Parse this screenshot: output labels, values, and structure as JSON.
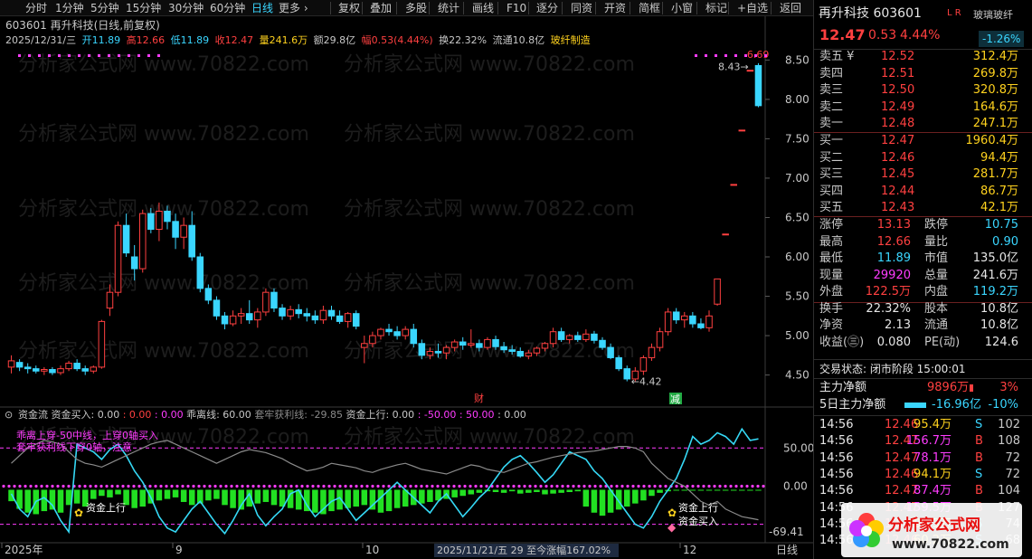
{
  "toolbar": {
    "items": [
      "分时",
      "1分钟",
      "5分钟",
      "15分钟",
      "30分钟",
      "60分钟",
      "日线",
      "更多 ›",
      "复权",
      "叠加",
      "多股",
      "统计",
      "画线",
      "F10",
      "逐分",
      "同资",
      "开资",
      "简框",
      "小窗",
      "标记",
      "+自选",
      "返回"
    ],
    "active": "日线"
  },
  "chart_header": {
    "title": "603601 再升科技(日线,前复权)",
    "date": "2025/12/31/三",
    "open": "开11.89",
    "high": "高12.66",
    "low": "低11.89",
    "close": "收12.47",
    "volume": "量241.6万",
    "amount": "额29.8亿",
    "change": "幅0.53(4.44%)",
    "turnover": "换22.32%",
    "float": "流通10.8亿",
    "sector": "玻纤制造"
  },
  "price_axis": {
    "labels": [
      "8.50",
      "8.00",
      "7.50",
      "7.00",
      "6.50",
      "6.00",
      "5.50",
      "5.00",
      "4.50"
    ],
    "min": 4.3,
    "max": 8.55
  },
  "annotations": {
    "high_label": "6.69",
    "low_label": "4.42",
    "right_label": "8.43",
    "cai": "财",
    "jian": "减"
  },
  "indicator": {
    "name": "资金流",
    "items": [
      {
        "label": "资金买入:",
        "value": "0.00"
      },
      {
        "label": ":",
        "value": "0.00"
      },
      {
        "label": ":",
        "value": "0.00"
      },
      {
        "label": "乖离线:",
        "value": "60.00"
      },
      {
        "label": "套牢获利线:",
        "value": "-29.85"
      },
      {
        "label": "资金上行:",
        "value": "0.00"
      },
      {
        "label": ":",
        "value": "-50.00"
      },
      {
        "label": ":",
        "value": "50.00"
      },
      {
        "label": ":",
        "value": "0.00"
      }
    ],
    "notes": [
      "乖离上穿-50中线，上穿0轴买入",
      "套牢获利线下穿0轴，注意"
    ],
    "marks": [
      "资金上行",
      "资金上行",
      "资金买入"
    ],
    "axis_labels": [
      "50.00",
      "0.00",
      "-69.41"
    ],
    "axis": {
      "min": -69.41,
      "max": 80
    }
  },
  "x_axis": {
    "labels": [
      "2025年",
      "9",
      "10",
      "12"
    ],
    "cursor": "2025/11/21/五 29 至今涨幅167.02%",
    "period": "日线"
  },
  "watermark": "分析家公式网 www.70822.com",
  "chart_data": {
    "type": "candlestick",
    "title": "603601 再升科技(日线,前复权)",
    "candles": [
      [
        4.6,
        4.75,
        4.52,
        4.68
      ],
      [
        4.66,
        4.7,
        4.55,
        4.6
      ],
      [
        4.6,
        4.65,
        4.52,
        4.58
      ],
      [
        4.58,
        4.62,
        4.52,
        4.55
      ],
      [
        4.55,
        4.6,
        4.5,
        4.57
      ],
      [
        4.57,
        4.6,
        4.5,
        4.53
      ],
      [
        4.53,
        4.62,
        4.5,
        4.58
      ],
      [
        4.58,
        4.68,
        4.55,
        4.65
      ],
      [
        4.65,
        4.7,
        4.55,
        4.58
      ],
      [
        4.58,
        4.62,
        4.5,
        4.55
      ],
      [
        4.55,
        4.62,
        4.52,
        4.6
      ],
      [
        4.6,
        5.2,
        4.58,
        5.18
      ],
      [
        5.35,
        5.65,
        5.25,
        5.55
      ],
      [
        5.55,
        6.45,
        5.5,
        6.4
      ],
      [
        6.4,
        6.55,
        6.0,
        6.05
      ],
      [
        6.0,
        6.15,
        5.7,
        5.85
      ],
      [
        5.85,
        6.6,
        5.8,
        6.55
      ],
      [
        6.55,
        6.62,
        6.3,
        6.35
      ],
      [
        6.35,
        6.69,
        6.2,
        6.58
      ],
      [
        6.58,
        6.65,
        6.35,
        6.45
      ],
      [
        6.45,
        6.55,
        6.1,
        6.25
      ],
      [
        6.25,
        6.5,
        6.1,
        6.4
      ],
      [
        6.4,
        6.58,
        5.95,
        6.0
      ],
      [
        6.0,
        6.05,
        5.55,
        5.6
      ],
      [
        5.6,
        5.65,
        5.4,
        5.45
      ],
      [
        5.45,
        5.5,
        5.2,
        5.25
      ],
      [
        5.25,
        5.3,
        5.08,
        5.15
      ],
      [
        5.15,
        5.32,
        5.12,
        5.25
      ],
      [
        5.25,
        5.35,
        5.15,
        5.28
      ],
      [
        5.28,
        5.45,
        5.15,
        5.2
      ],
      [
        5.2,
        5.35,
        5.1,
        5.3
      ],
      [
        5.3,
        5.6,
        5.25,
        5.55
      ],
      [
        5.55,
        5.6,
        5.3,
        5.35
      ],
      [
        5.35,
        5.4,
        5.2,
        5.25
      ],
      [
        5.25,
        5.38,
        5.2,
        5.33
      ],
      [
        5.33,
        5.4,
        5.22,
        5.28
      ],
      [
        5.28,
        5.35,
        5.18,
        5.25
      ],
      [
        5.25,
        5.32,
        5.15,
        5.2
      ],
      [
        5.2,
        5.38,
        5.15,
        5.32
      ],
      [
        5.32,
        5.38,
        5.2,
        5.25
      ],
      [
        5.25,
        5.32,
        5.15,
        5.18
      ],
      [
        5.18,
        5.3,
        5.1,
        5.28
      ],
      [
        5.28,
        5.32,
        5.08,
        5.12
      ],
      [
        4.85,
        5.0,
        4.65,
        4.9
      ],
      [
        4.9,
        5.05,
        4.85,
        5.0
      ],
      [
        5.0,
        5.1,
        4.95,
        5.08
      ],
      [
        5.08,
        5.15,
        5.0,
        5.05
      ],
      [
        5.05,
        5.12,
        4.95,
        5.0
      ],
      [
        5.0,
        5.12,
        4.95,
        5.08
      ],
      [
        5.08,
        5.15,
        4.85,
        4.9
      ],
      [
        4.9,
        4.95,
        4.7,
        4.75
      ],
      [
        4.75,
        4.85,
        4.7,
        4.8
      ],
      [
        4.8,
        4.9,
        4.72,
        4.78
      ],
      [
        4.78,
        4.88,
        4.7,
        4.85
      ],
      [
        4.85,
        4.95,
        4.8,
        4.92
      ],
      [
        4.92,
        4.98,
        4.82,
        4.88
      ],
      [
        4.88,
        5.08,
        4.85,
        4.9
      ],
      [
        4.9,
        4.95,
        4.8,
        4.85
      ],
      [
        4.85,
        4.98,
        4.82,
        4.95
      ],
      [
        4.95,
        5.0,
        4.82,
        4.86
      ],
      [
        4.86,
        4.92,
        4.78,
        4.82
      ],
      [
        4.82,
        4.88,
        4.76,
        4.8
      ],
      [
        4.8,
        4.85,
        4.72,
        4.74
      ],
      [
        4.74,
        4.82,
        4.7,
        4.78
      ],
      [
        4.78,
        4.86,
        4.74,
        4.84
      ],
      [
        4.84,
        4.92,
        4.8,
        4.9
      ],
      [
        4.9,
        5.1,
        4.85,
        5.05
      ],
      [
        5.05,
        5.1,
        4.92,
        4.95
      ],
      [
        4.95,
        5.02,
        4.9,
        5.0
      ],
      [
        5.0,
        5.05,
        4.92,
        4.95
      ],
      [
        4.95,
        5.08,
        4.92,
        5.02
      ],
      [
        5.02,
        5.06,
        4.9,
        4.94
      ],
      [
        4.94,
        4.98,
        4.82,
        4.85
      ],
      [
        4.85,
        4.9,
        4.7,
        4.72
      ],
      [
        4.72,
        4.75,
        4.55,
        4.58
      ],
      [
        4.58,
        4.62,
        4.42,
        4.45
      ],
      [
        4.45,
        4.6,
        4.42,
        4.55
      ],
      [
        4.55,
        4.75,
        4.5,
        4.72
      ],
      [
        4.72,
        4.9,
        4.68,
        4.85
      ],
      [
        4.85,
        5.1,
        4.8,
        5.05
      ],
      [
        5.05,
        5.35,
        5.0,
        5.3
      ],
      [
        5.3,
        5.35,
        5.15,
        5.2
      ],
      [
        5.2,
        5.3,
        5.1,
        5.25
      ],
      [
        5.25,
        5.3,
        5.1,
        5.15
      ],
      [
        5.15,
        5.22,
        5.08,
        5.1
      ],
      [
        5.1,
        5.32,
        5.05,
        5.25
      ],
      [
        5.4,
        5.72,
        5.38,
        5.72
      ],
      [
        6.29,
        6.29,
        6.29,
        6.29
      ],
      [
        6.92,
        6.92,
        6.92,
        6.92
      ],
      [
        7.61,
        7.61,
        7.61,
        7.61
      ],
      [
        8.37,
        8.37,
        8.37,
        8.37
      ],
      [
        8.43,
        8.46,
        7.9,
        7.92
      ]
    ],
    "ylim": [
      4.3,
      8.55
    ]
  }
}
